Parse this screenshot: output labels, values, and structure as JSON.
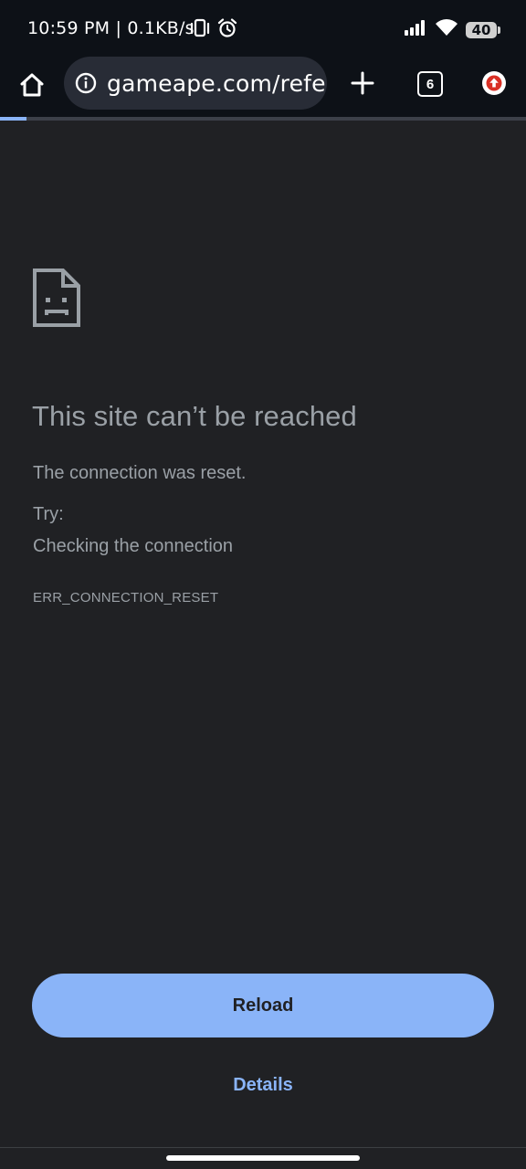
{
  "status_bar": {
    "time_speed": "10:59 PM | 0.1KB/s",
    "icons_left": [
      "vibrate-icon",
      "alarm-icon"
    ],
    "icons_right": [
      "signal-icon",
      "wifi-icon",
      "battery-icon"
    ],
    "battery_level": "40"
  },
  "toolbar": {
    "url": "gameape.com/refer",
    "tab_count": "6",
    "icons": [
      "home-icon",
      "info-icon",
      "add-icon",
      "tab-switcher-icon",
      "update-icon"
    ]
  },
  "progress": {
    "fraction": 0.05
  },
  "error_page": {
    "title": "This site can’t be reached",
    "description": "The connection was reset.",
    "try_label": "Try:",
    "suggestion": "Checking the connection",
    "error_code": "ERR_CONNECTION_RESET",
    "reload_label": "Reload",
    "details_label": "Details"
  },
  "colors": {
    "background": "#202124",
    "accent": "#8ab4f8",
    "update_badge": "#d93025"
  }
}
